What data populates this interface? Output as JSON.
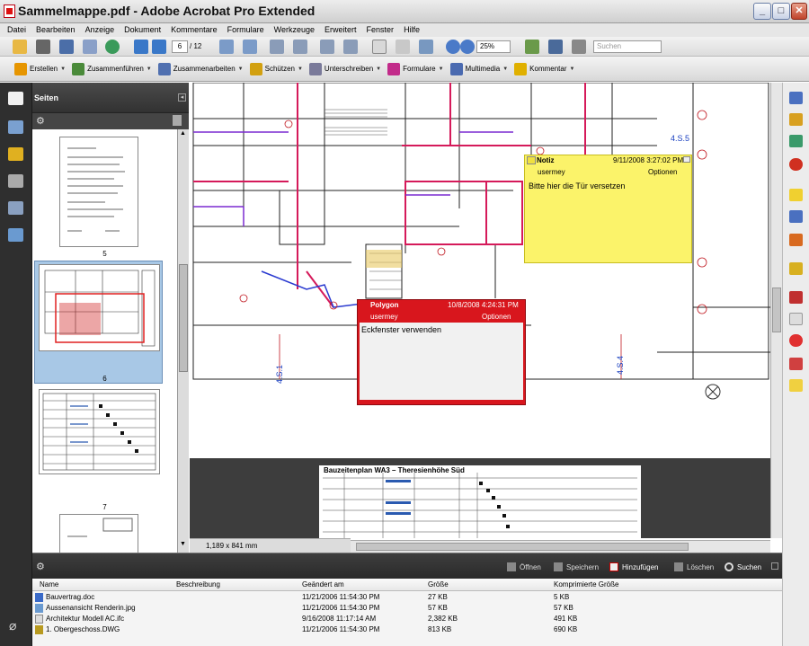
{
  "window": {
    "title": "Sammelmappe.pdf - Adobe Acrobat Pro Extended"
  },
  "menu": [
    "Datei",
    "Bearbeiten",
    "Anzeige",
    "Dokument",
    "Kommentare",
    "Formulare",
    "Werkzeuge",
    "Erweitert",
    "Fenster",
    "Hilfe"
  ],
  "toolbar": {
    "page_current": "6",
    "page_total": "/ 12",
    "zoom": "25%",
    "search_placeholder": "Suchen"
  },
  "toolbar2": [
    {
      "label": "Erstellen",
      "icon": "create-icon",
      "color": "#e69500"
    },
    {
      "label": "Zusammenführen",
      "icon": "combine-icon",
      "color": "#4a8a3a"
    },
    {
      "label": "Zusammenarbeiten",
      "icon": "collaborate-icon",
      "color": "#5070b0"
    },
    {
      "label": "Schützen",
      "icon": "lock-icon",
      "color": "#d2a010"
    },
    {
      "label": "Unterschreiben",
      "icon": "pen-icon",
      "color": "#7a7a9a"
    },
    {
      "label": "Formulare",
      "icon": "forms-icon",
      "color": "#c22b8a"
    },
    {
      "label": "Multimedia",
      "icon": "multimedia-icon",
      "color": "#4a6ab0"
    },
    {
      "label": "Kommentar",
      "icon": "comment-icon",
      "color": "#e0b000"
    }
  ],
  "pages_panel": {
    "title": "Seiten",
    "page_labels": [
      "5",
      "6",
      "7"
    ]
  },
  "status": {
    "page_size": "1,189 x 841 mm"
  },
  "note_yellow": {
    "type": "Notiz",
    "date": "9/11/2008 3:27:02 PM",
    "author": "usermey",
    "options": "Optionen",
    "text": "Bitte hier die Tür versetzen"
  },
  "note_red": {
    "type": "Polygon",
    "date": "10/8/2008 4:24:31 PM",
    "author": "usermey",
    "options": "Optionen",
    "text": "Eckfenster verwenden"
  },
  "doc": {
    "schedule_title": "Bauzeitenplan  WA3 – Theresienhöhe Süd",
    "label_a": "4.S.5",
    "label_b": "4.S.1",
    "label_c": "4.S.4"
  },
  "bottom": {
    "tools": [
      "Öffnen",
      "Speichern",
      "Hinzufügen",
      "Löschen",
      "Suchen"
    ],
    "columns": [
      "Name",
      "Beschreibung",
      "Geändert am",
      "Größe",
      "Komprimierte Größe"
    ],
    "rows": [
      {
        "name": "Bauvertrag.doc",
        "desc": "",
        "modified": "11/21/2006 11:54:30 PM",
        "size": "27 KB",
        "compressed": "5 KB"
      },
      {
        "name": "Aussenansicht Renderin.jpg",
        "desc": "",
        "modified": "11/21/2006 11:54:30 PM",
        "size": "57 KB",
        "compressed": "57 KB"
      },
      {
        "name": "Architektur Modell AC.ifc",
        "desc": "",
        "modified": "9/16/2008 11:17:14 AM",
        "size": "2,382 KB",
        "compressed": "491 KB"
      },
      {
        "name": "1. Obergeschoss.DWG",
        "desc": "",
        "modified": "11/21/2006 11:54:30 PM",
        "size": "813 KB",
        "compressed": "690 KB"
      }
    ]
  }
}
